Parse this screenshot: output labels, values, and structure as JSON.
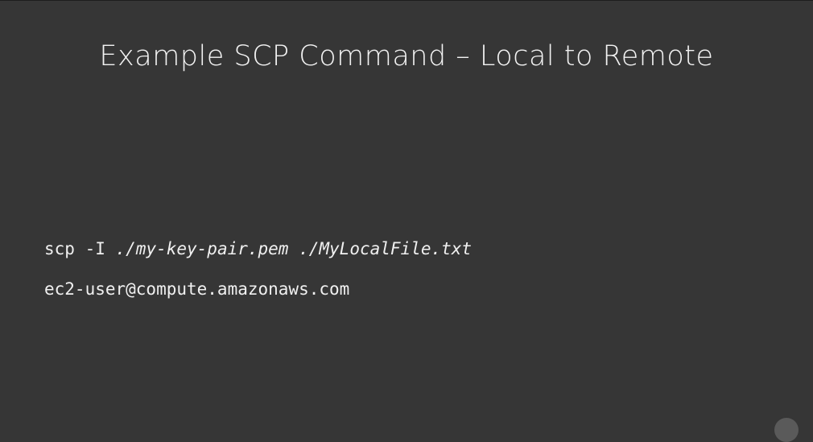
{
  "slide": {
    "title": "Example SCP Command – Local to Remote",
    "command": {
      "line1_prefix": "scp -I ",
      "line1_key": "./my-key-pair.pem",
      "line1_space": " ",
      "line1_file": "./MyLocalFile.txt",
      "line2": "ec2-user@compute.amazonaws.com"
    }
  },
  "colors": {
    "background": "#363636",
    "text": "#f2f2f2"
  }
}
